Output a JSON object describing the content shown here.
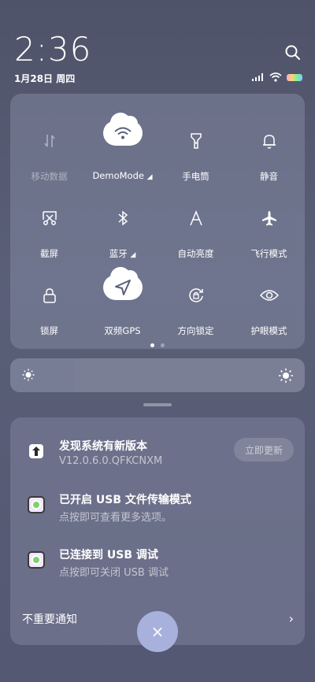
{
  "status_bar": {
    "time": "2:36",
    "date": "1月28日 周四"
  },
  "quick_settings": {
    "tiles": [
      {
        "label": "移动数据",
        "icon": "mobile-data-icon",
        "state": "disabled"
      },
      {
        "label": "DemoMode",
        "icon": "wifi-icon",
        "state": "on",
        "has_menu": true
      },
      {
        "label": "手电筒",
        "icon": "flashlight-icon",
        "state": "off"
      },
      {
        "label": "静音",
        "icon": "bell-icon",
        "state": "off"
      },
      {
        "label": "截屏",
        "icon": "screenshot-icon",
        "state": "off"
      },
      {
        "label": "蓝牙",
        "icon": "bluetooth-icon",
        "state": "off",
        "has_menu": true
      },
      {
        "label": "自动亮度",
        "icon": "auto-brightness-icon",
        "state": "off"
      },
      {
        "label": "飞行模式",
        "icon": "airplane-icon",
        "state": "off"
      },
      {
        "label": "锁屏",
        "icon": "lock-icon",
        "state": "off"
      },
      {
        "label": "双频GPS",
        "icon": "gps-icon",
        "state": "on"
      },
      {
        "label": "方向锁定",
        "icon": "rotation-lock-icon",
        "state": "off"
      },
      {
        "label": "护眼模式",
        "icon": "eye-icon",
        "state": "off"
      }
    ],
    "page_count": 2,
    "current_page": 1
  },
  "brightness": {
    "level": 0.22
  },
  "notifications": {
    "items": [
      {
        "title": "发现系统有新版本",
        "subtitle": "V12.0.6.0.QFKCNXM",
        "action": "立即更新"
      },
      {
        "title": "已开启 USB 文件传输模式",
        "subtitle": "点按即可查看更多选项。"
      },
      {
        "title": "已连接到 USB 调试",
        "subtitle": "点按即可关闭 USB 调试"
      }
    ],
    "unimportant_label": "不重要通知"
  },
  "close_button": {
    "label": "×"
  }
}
